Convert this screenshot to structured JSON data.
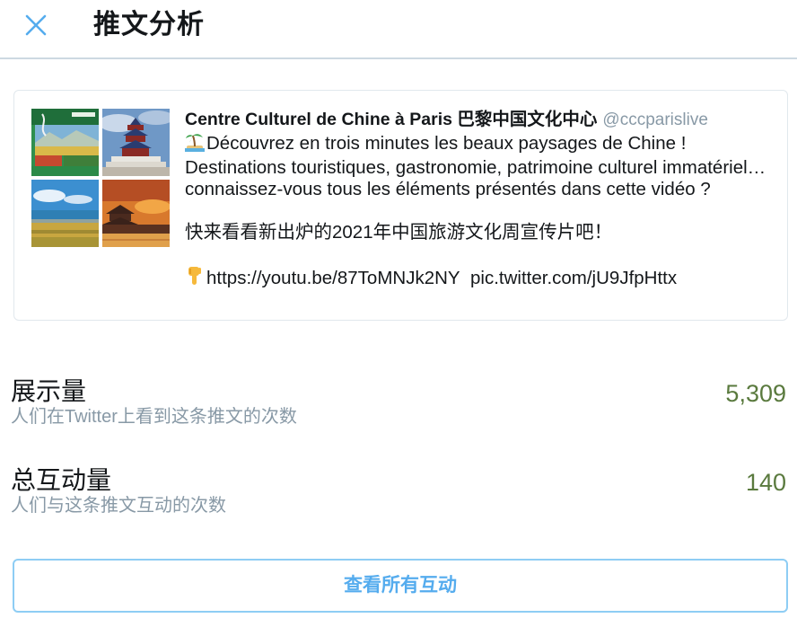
{
  "header": {
    "title": "推文分析",
    "close_icon": "close-icon"
  },
  "tweet": {
    "author_name": "Centre Culturel de Chine à Paris 巴黎中国文化中心",
    "author_handle": "@cccparislive",
    "text_fr": "Découvrez en trois minutes les beaux paysages de Chine ! Destinations touristiques, gastronomie, patrimoine culturel immatériel… connaissez-vous tous les éléments présentés dans cette vidéo ?",
    "text_cn": "快来看看新出炉的2021年中国旅游文化周宣传片吧！",
    "link_youtube": "https://youtu.be/87ToMNJk2NY",
    "link_pic": "pic.twitter.com/jU9JfpHttx",
    "emoji_island": "island-emoji",
    "emoji_point_down": "pointing-down-emoji",
    "media": [
      "promo-poster",
      "temple-of-heaven",
      "lake-landscape",
      "forbidden-city-sunset"
    ]
  },
  "metrics": [
    {
      "label": "展示量",
      "desc": "人们在Twitter上看到这条推文的次数",
      "value": "5,309"
    },
    {
      "label": "总互动量",
      "desc": "人们与这条推文互动的次数",
      "value": "140"
    }
  ],
  "actions": {
    "view_all_label": "查看所有互动"
  },
  "colors": {
    "accent": "#55acee",
    "value_green": "#5a7a3e",
    "muted": "#8899a6",
    "divider": "#cdd9e2"
  }
}
